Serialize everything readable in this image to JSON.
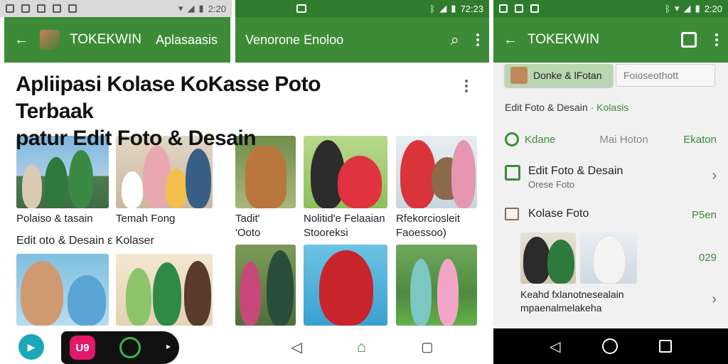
{
  "screen1": {
    "status_time": "2:20",
    "appbar_title": "TOKEKWIN",
    "appbar_subtitle": "Aplasaasis",
    "headline_line1": "Apliipasi Kolase KoKasse Poto Terbaak",
    "headline_line2": "patur Edit Foto & Desain",
    "captions": [
      "Polaiso & tasain",
      "Temah Fong"
    ],
    "section_label": "Edit oto & Desain ε Kolaser",
    "nav_badge": "U9"
  },
  "screen2": {
    "status_time": "72:23",
    "appbar_title": "Venorone Enoloo",
    "captions": [
      "Tadit'",
      "'Ooto",
      "Nolitid'e Felaaian",
      "Stooreksi",
      "Rfekorciosleit",
      "Faoessoo)"
    ]
  },
  "screen3": {
    "status_time": "2:20",
    "appbar_title": "TOKEKWIN",
    "tab_active": "Donke & lFotan",
    "tab_inactive": "Foioseothott",
    "breadcrumb": "Edit Foto & Desain",
    "breadcrumb_accent": "· Kolasis",
    "filter_a": "Kdane",
    "filter_b": "Mai Hoton",
    "filter_c": "Ekaton",
    "item1_title": "Edit Foto & Desain",
    "item1_sub": "Orese Foto",
    "item2_title": "Kolase Foto",
    "item2_right": "P5en",
    "item2_value": "029",
    "item3_line1": "Keahd fxlanotnesealain",
    "item3_line2": "mpaenalmelakeha"
  },
  "colors": {
    "brand_green": "#3d8b37",
    "dark_green": "#2f7d2c",
    "accent_teal": "#1ba8b8",
    "accent_pink": "#e2196b"
  }
}
